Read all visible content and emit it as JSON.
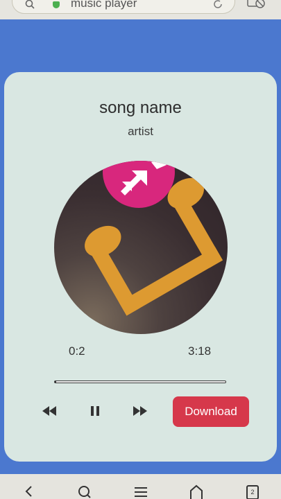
{
  "browser": {
    "url_text": "music player",
    "tab_count": "2"
  },
  "player": {
    "song_title": "song name",
    "artist": "artist",
    "current_time": "0:2",
    "total_time": "3:18",
    "progress_fraction": 0.01,
    "download_label": "Download"
  },
  "colors": {
    "page_background": "#4b78cf",
    "card_background": "#d9e7e2",
    "download_button": "#d6384b",
    "note_color": "#dd9a31",
    "badge_color": "#d8277d"
  },
  "icons": {
    "rewind": "rewind-icon",
    "pause": "pause-icon",
    "fast_forward": "fast-forward-icon"
  }
}
